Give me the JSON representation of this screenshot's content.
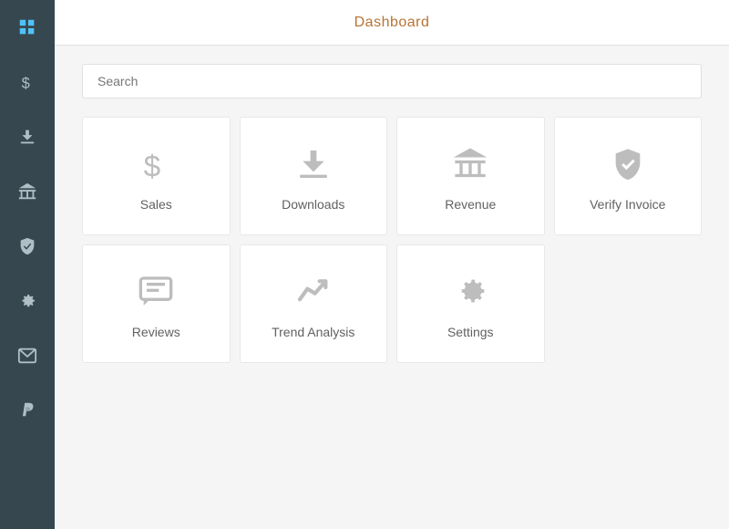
{
  "header": {
    "title": "Dashboard"
  },
  "search": {
    "placeholder": "Search"
  },
  "sidebar": {
    "items": [
      {
        "name": "dashboard",
        "icon": "grid",
        "active": true
      },
      {
        "name": "sales",
        "icon": "dollar"
      },
      {
        "name": "downloads",
        "icon": "download"
      },
      {
        "name": "revenue",
        "icon": "bank"
      },
      {
        "name": "verify",
        "icon": "shield"
      },
      {
        "name": "settings",
        "icon": "gear"
      },
      {
        "name": "email",
        "icon": "mail"
      },
      {
        "name": "paypal",
        "icon": "paypal"
      }
    ]
  },
  "cards": [
    {
      "id": "sales",
      "label": "Sales"
    },
    {
      "id": "downloads",
      "label": "Downloads"
    },
    {
      "id": "revenue",
      "label": "Revenue"
    },
    {
      "id": "verify-invoice",
      "label": "Verify Invoice"
    },
    {
      "id": "reviews",
      "label": "Reviews"
    },
    {
      "id": "trend-analysis",
      "label": "Trend Analysis"
    },
    {
      "id": "settings",
      "label": "Settings"
    }
  ]
}
